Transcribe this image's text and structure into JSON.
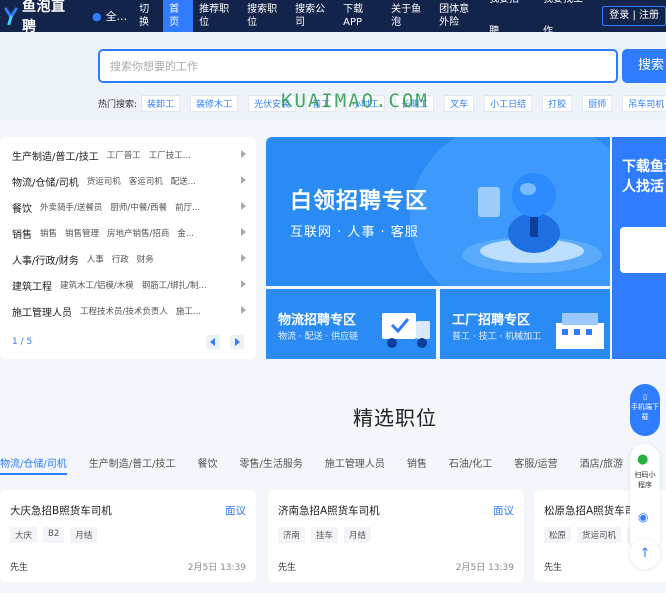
{
  "header": {
    "logo_text": "鱼泡直聘",
    "city": "全...",
    "nav": [
      {
        "label": "切换"
      },
      {
        "label": "首页"
      },
      {
        "label": "推荐职位"
      },
      {
        "label": "搜索职位"
      },
      {
        "label": "搜索公司"
      },
      {
        "label": "下载APP"
      },
      {
        "label": "关于鱼泡"
      },
      {
        "label": "团体意外险"
      }
    ],
    "right": [
      {
        "label": "我要招聘"
      },
      {
        "label": "我要找工作"
      }
    ],
    "login_label": "登录 | 注册",
    "colors": {
      "bg": "#13244a",
      "accent": "#2f7cff"
    }
  },
  "search": {
    "placeholder": "搜索你想要的工作",
    "button_label": "搜索",
    "hot_label": "热门搜索:",
    "hot_tags": [
      "装卸工",
      "装修木工",
      "光伏安装",
      "普工",
      "小时工",
      "长期工",
      "叉车",
      "小工日结",
      "打胶",
      "厨师",
      "吊车司机"
    ],
    "watermark": "KUAIMAO.COM"
  },
  "categories": {
    "rows": [
      {
        "main": "生产制造/普工/技工",
        "subs": [
          "工厂普工",
          "工厂技工..."
        ]
      },
      {
        "main": "物流/仓储/司机",
        "subs": [
          "货运司机",
          "客运司机",
          "配送..."
        ]
      },
      {
        "main": "餐饮",
        "subs": [
          "外卖骑手/送餐员",
          "厨师/中餐/西餐",
          "前厅..."
        ]
      },
      {
        "main": "销售",
        "subs": [
          "销售",
          "销售管理",
          "房地产销售/招商",
          "金..."
        ]
      },
      {
        "main": "人事/行政/财务",
        "subs": [
          "人事",
          "行政",
          "财务"
        ]
      },
      {
        "main": "建筑工程",
        "subs": [
          "建筑木工/铝模/木模",
          "钢筋工/绑扎/制..."
        ]
      },
      {
        "main": "施工管理人员",
        "subs": [
          "工程技术员/技术负责人",
          "施工..."
        ]
      }
    ],
    "pager": "1 / 5"
  },
  "banners": {
    "big": {
      "title": "白领招聘专区",
      "sub": "互联网 · 人事 · 客服"
    },
    "left": {
      "title": "物流招聘专区",
      "sub": "物流 · 配送 · 供应链"
    },
    "right": {
      "title": "工厂招聘专区",
      "sub": "普工 · 技工 · 机械加工"
    },
    "side": {
      "title": "下载鱼泡 招人找活"
    }
  },
  "section": {
    "title": "精选职位",
    "tabs": [
      "物流/仓储/司机",
      "生产制造/普工/技工",
      "餐饮",
      "零售/生活服务",
      "施工管理人员",
      "销售",
      "石油/化工",
      "客服/运营",
      "酒店/旅游",
      "人"
    ]
  },
  "jobs": [
    {
      "title": "大庆急招B照货车司机",
      "salary": "面议",
      "tags": [
        "大庆",
        "B2",
        "月结"
      ],
      "poster": "先生",
      "time": "2月5日 13:39"
    },
    {
      "title": "济南急招A照货车司机",
      "salary": "面议",
      "tags": [
        "济南",
        "挂车",
        "月结"
      ],
      "poster": "先生",
      "time": "2月5日 13:39"
    },
    {
      "title": "松原急招A照货车司机",
      "salary": "面议",
      "tags": [
        "松原",
        "货运司机",
        "月结"
      ],
      "poster": "先生",
      "time": "2月5日 13:39"
    }
  ],
  "float": {
    "app": "手机端下载",
    "mini": "扫码小程序"
  }
}
